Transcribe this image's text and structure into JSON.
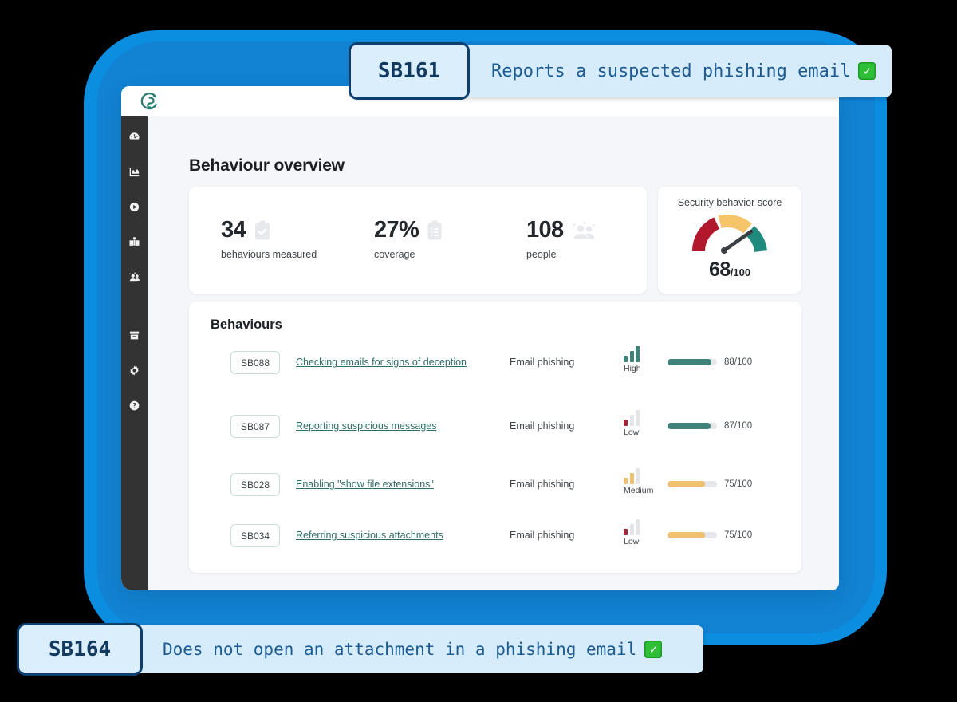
{
  "callouts": {
    "top": {
      "id": "SB161",
      "text": "Reports a suspected phishing email",
      "check": "✓"
    },
    "bottom": {
      "id": "SB164",
      "text": "Does not open an attachment in a phishing email",
      "check": "✓"
    }
  },
  "app": {
    "logo_name": "huntress-logo-icon",
    "sidebar": [
      {
        "icon": "gauge-icon",
        "label": "Dashboard"
      },
      {
        "icon": "chart-icon",
        "label": "Analytics"
      },
      {
        "icon": "play-circle-icon",
        "label": "Training"
      },
      {
        "icon": "book-icon",
        "label": "Learning"
      },
      {
        "icon": "people-icon",
        "label": "People"
      },
      {
        "icon": "archive-icon",
        "label": "Archive"
      },
      {
        "icon": "gear-icon",
        "label": "Settings"
      },
      {
        "icon": "help-circle-icon",
        "label": "Help"
      }
    ],
    "page_title": "Behaviour overview",
    "stats": [
      {
        "value": "34",
        "label": "behaviours measured",
        "icon": "clipboard-check-icon"
      },
      {
        "value": "27%",
        "label": "coverage",
        "icon": "clipboard-list-icon"
      },
      {
        "value": "108",
        "label": "people",
        "icon": "people-icon"
      }
    ],
    "gauge": {
      "title": "Security behavior score",
      "score": "68",
      "denominator": "/100",
      "value": 68,
      "max": 100,
      "segments": [
        {
          "name": "low",
          "color": "#b2182b",
          "from": 0,
          "to": 45
        },
        {
          "name": "medium",
          "color": "#f6c56a",
          "from": 45,
          "to": 73
        },
        {
          "name": "high",
          "color": "#1f8a7d",
          "from": 73,
          "to": 100
        }
      ]
    },
    "behaviours": {
      "title": "Behaviours",
      "rows": [
        {
          "id": "SB088",
          "name": "Checking emails for signs of deception",
          "category": "Email phishing",
          "risk": "High",
          "risk_level": 3,
          "risk_color": "#3f8279",
          "score": "88/100",
          "score_pct": 88,
          "score_color": "#3f8279"
        },
        {
          "id": "SB087",
          "name": "Reporting suspicious messages",
          "category": "Email phishing",
          "risk": "Low",
          "risk_level": 1,
          "risk_color": "#a32638",
          "score": "87/100",
          "score_pct": 87,
          "score_color": "#3f8279"
        },
        {
          "id": "SB028",
          "name": "Enabling \"show file extensions\"",
          "category": "Email phishing",
          "risk": "Medium",
          "risk_level": 2,
          "risk_color": "#efc070",
          "score": "75/100",
          "score_pct": 75,
          "score_color": "#efc070"
        },
        {
          "id": "SB034",
          "name": "Referring suspicious attachments",
          "category": "Email phishing",
          "risk": "Low",
          "risk_level": 1,
          "risk_color": "#a32638",
          "score": "75/100",
          "score_pct": 75,
          "score_color": "#efc070"
        }
      ]
    }
  },
  "colors": {
    "frame_outer": "#0b8de0",
    "frame_inner": "#1282d2",
    "sidebar": "#333333",
    "content_bg": "#f4f6f9",
    "teal": "#3f8279",
    "amber": "#efc070",
    "red": "#a32638",
    "callout_bg": "#d6ecfb",
    "callout_border": "#0d3f6e"
  }
}
